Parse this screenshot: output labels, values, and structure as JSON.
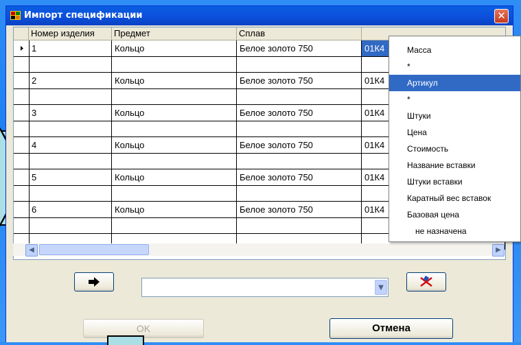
{
  "window": {
    "title": "Импорт спецификации",
    "close": "✕"
  },
  "grid": {
    "headers": [
      "Номер изделия",
      "Предмет",
      "Сплав",
      ""
    ],
    "rows": [
      [
        "1",
        "Кольцо",
        "Белое золото 750",
        "01К4"
      ],
      [
        "2",
        "Кольцо",
        "Белое золото 750",
        "01К4"
      ],
      [
        "3",
        "Кольцо",
        "Белое золото 750",
        "01К4"
      ],
      [
        "4",
        "Кольцо",
        "Белое золото 750",
        "01К4"
      ],
      [
        "5",
        "Кольцо",
        "Белое золото 750",
        "01К4"
      ],
      [
        "6",
        "Кольцо",
        "Белое золото 750",
        "01К4"
      ]
    ]
  },
  "dropdown": {
    "items": [
      "Масса",
      "*",
      "Артикул",
      "*",
      "Штуки",
      "Цена",
      "Стоимость",
      "Название вставки",
      "Штуки вставки",
      "Каратный вес вставок",
      "Базовая цена",
      "не назначена"
    ],
    "selected_index": 2
  },
  "buttons": {
    "ok": "OK",
    "cancel": "Отмена"
  },
  "combo": {
    "value": ""
  },
  "colors": {
    "selection": "#316ac5",
    "callout": "#aadfe6"
  }
}
